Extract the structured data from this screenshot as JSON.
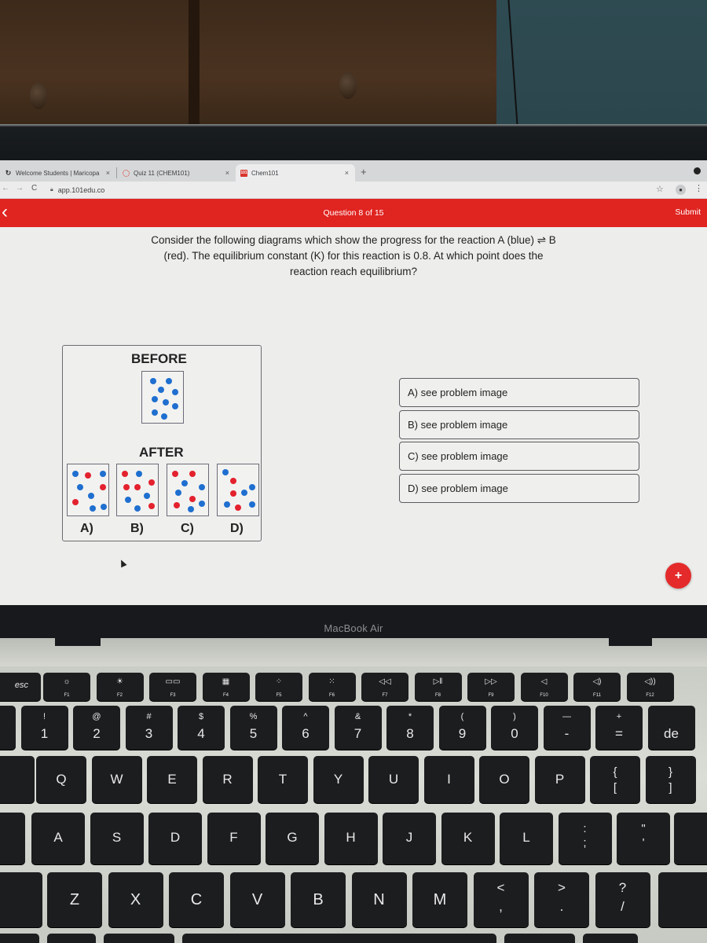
{
  "browser": {
    "tabs": [
      {
        "label": "Welcome Students | Maricopa",
        "icon": "canvas-logo-icon",
        "active": false
      },
      {
        "label": "Quiz 11 (CHEM101)",
        "icon": "quiz-logo-icon",
        "active": false
      },
      {
        "label": "Chem101",
        "icon": "chem101-logo-icon",
        "active": true
      }
    ],
    "favicon_101_text": "101",
    "new_tab_label": "+",
    "close_glyph": "×",
    "url": "app.101edu.co",
    "nav": {
      "back": "←",
      "forward": "→",
      "reload": "C"
    },
    "star_glyph": "☆",
    "menu_glyph": "⋮",
    "account_glyph": "●"
  },
  "appbar": {
    "back_glyph": "‹",
    "title": "Question 8 of 15",
    "submit_label": "Submit",
    "color": "#e02420"
  },
  "question": {
    "text": "Consider the following diagrams which show the progress for the reaction A (blue) ⇌ B (red). The equilibrium constant (K) for this reaction is 0.8. At which point does the reaction reach equilibrium?"
  },
  "figure": {
    "before_label": "BEFORE",
    "after_label": "AFTER",
    "colors": {
      "A_blue": "#1f6fd0",
      "B_red": "#e3222e"
    },
    "before": {
      "blue": 9,
      "red": 0
    },
    "after_boxes": [
      {
        "label": "A)",
        "blue": 6,
        "red": 3
      },
      {
        "label": "B)",
        "blue": 4,
        "red": 5
      },
      {
        "label": "C)",
        "blue": 5,
        "red": 4
      },
      {
        "label": "D)",
        "blue": 5,
        "red": 3
      }
    ]
  },
  "choices": [
    {
      "label": "A) see problem image"
    },
    {
      "label": "B) see problem image"
    },
    {
      "label": "C) see problem image"
    },
    {
      "label": "D) see problem image"
    }
  ],
  "fab_label": "+",
  "device": {
    "label": "MacBook Air",
    "fn_row": [
      {
        "label": "esc",
        "icon": ""
      },
      {
        "label": "F1",
        "icon": "☼"
      },
      {
        "label": "F2",
        "icon": "☀"
      },
      {
        "label": "F3",
        "icon": "▭▭"
      },
      {
        "label": "F4",
        "icon": "▦"
      },
      {
        "label": "F5",
        "icon": "⁘"
      },
      {
        "label": "F6",
        "icon": "⁙"
      },
      {
        "label": "F7",
        "icon": "◁◁"
      },
      {
        "label": "F8",
        "icon": "▷‖"
      },
      {
        "label": "F9",
        "icon": "▷▷"
      },
      {
        "label": "F10",
        "icon": "◁"
      },
      {
        "label": "F11",
        "icon": "◁)"
      },
      {
        "label": "F12",
        "icon": "◁))"
      }
    ],
    "number_row": [
      {
        "top": "~",
        "bottom": ""
      },
      {
        "top": "!",
        "bottom": "1"
      },
      {
        "top": "@",
        "bottom": "2"
      },
      {
        "top": "#",
        "bottom": "3"
      },
      {
        "top": "$",
        "bottom": "4"
      },
      {
        "top": "%",
        "bottom": "5"
      },
      {
        "top": "^",
        "bottom": "6"
      },
      {
        "top": "&",
        "bottom": "7"
      },
      {
        "top": "*",
        "bottom": "8"
      },
      {
        "top": "(",
        "bottom": "9"
      },
      {
        "top": ")",
        "bottom": "0"
      },
      {
        "top": "—",
        "bottom": "-"
      },
      {
        "top": "+",
        "bottom": "="
      },
      {
        "top": "",
        "bottom": "de"
      }
    ],
    "qwerty_row": [
      "Q",
      "W",
      "E",
      "R",
      "T",
      "Y",
      "U",
      "I",
      "O",
      "P",
      "{ [",
      "} ]"
    ],
    "home_row": [
      "A",
      "S",
      "D",
      "F",
      "G",
      "H",
      "J",
      "K",
      "L",
      ": ;",
      "\" '"
    ],
    "bottom_row": [
      "Z",
      "X",
      "C",
      "V",
      "B",
      "N",
      "M",
      "< ,",
      "> .",
      "? /"
    ]
  }
}
